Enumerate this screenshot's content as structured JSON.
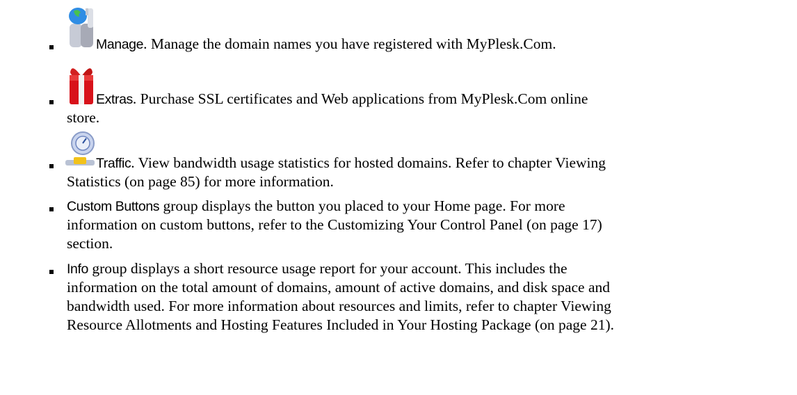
{
  "items": [
    {
      "term": "Manage",
      "desc": ". Manage the domain names you have registered with MyPlesk.Com.",
      "icon": "manage-tools-icon"
    },
    {
      "term": "Extras",
      "desc_l1": ". Purchase SSL certificates and Web applications from MyPlesk.Com online",
      "desc_l2": "store.",
      "icon": "gift-box-icon"
    },
    {
      "term": "Traffic",
      "desc_l1": ". View bandwidth usage statistics for hosted domains. Refer to chapter Viewing",
      "desc_l2": "Statistics (on page 85) for more information.",
      "icon": "traffic-gauge-icon"
    },
    {
      "term": "Custom Buttons",
      "desc_l1": " group displays the button you placed to your Home page. For more",
      "desc_l2": "information on custom buttons, refer to the Customizing Your Control Panel (on page 17)",
      "desc_l3": "section."
    },
    {
      "term": "Info",
      "desc_l1": " group displays a short resource usage report for your account. This includes the",
      "desc_l2": "information on the total amount of domains, amount of active domains, and disk space and",
      "desc_l3": "bandwidth used. For more information about resources and limits, refer to chapter Viewing",
      "desc_l4": "Resource Allotments and Hosting Features Included in Your Hosting Package (on page 21)."
    }
  ]
}
